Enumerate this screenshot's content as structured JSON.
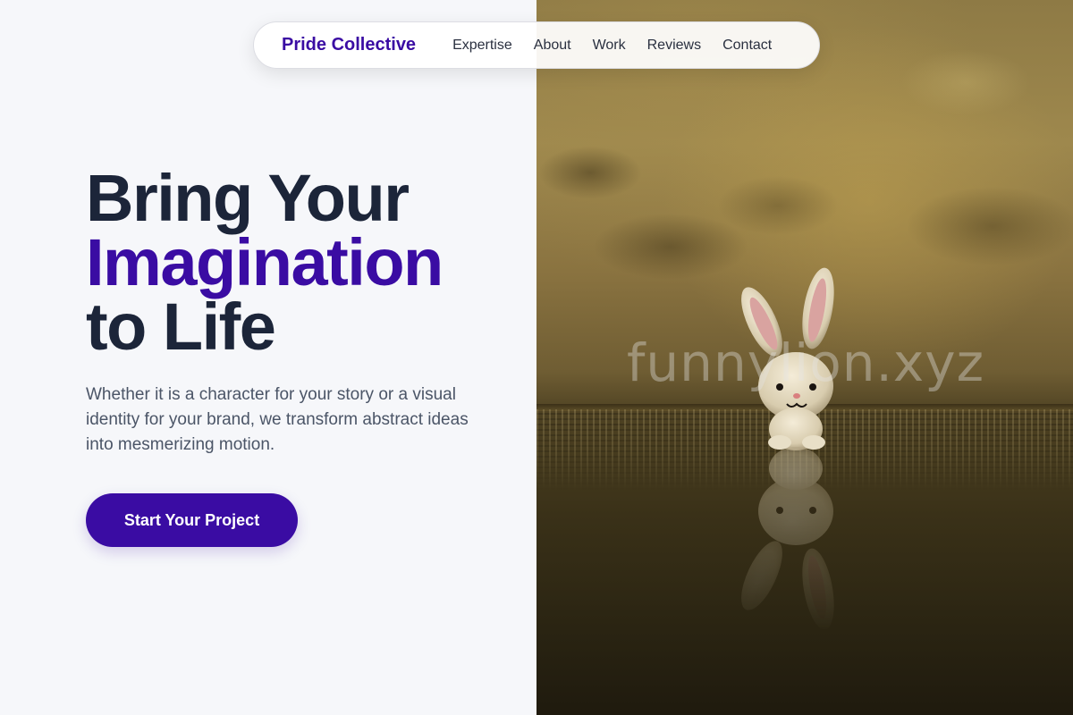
{
  "nav": {
    "brand": "Pride Collective",
    "links": [
      "Expertise",
      "About",
      "Work",
      "Reviews",
      "Contact"
    ]
  },
  "hero": {
    "title_line1": "Bring Your",
    "title_line2": "Imagination",
    "title_line3": "to Life",
    "description": "Whether it is a character for your story or a visual identity for your brand, we transform abstract ideas into mesmerizing motion.",
    "cta_label": "Start Your Project"
  },
  "image": {
    "watermark": "funnylion.xyz"
  },
  "colors": {
    "accent": "#3a0ca3",
    "heading": "#1c2539",
    "body_text": "#4b5567",
    "background": "#f6f7fa"
  }
}
